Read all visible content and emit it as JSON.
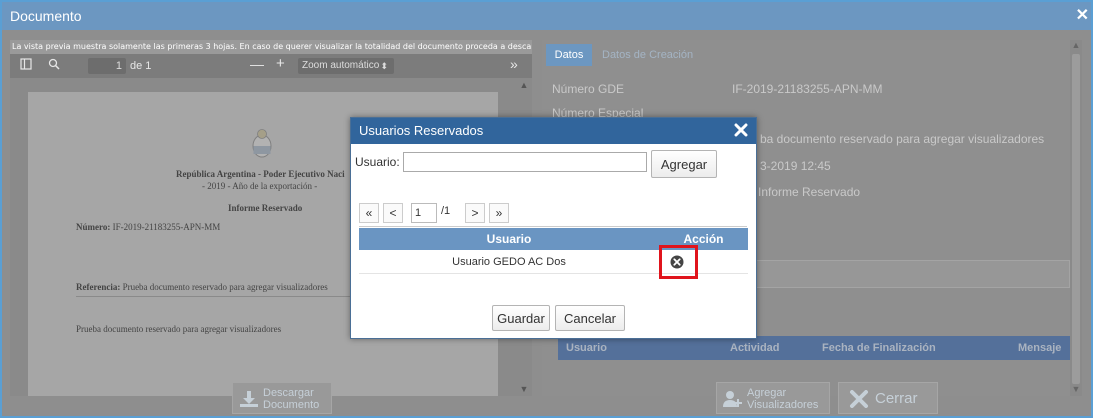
{
  "window": {
    "title": "Documento"
  },
  "viewer": {
    "notice": "La vista previa muestra solamente las primeras 3 hojas. En caso de querer visualizar la totalidad del documento proceda a descargarlo.",
    "page_current": "1",
    "page_total": "de 1",
    "zoom_minus": "—",
    "zoom_plus": "+",
    "zoom_value": "Zoom automático",
    "more": "»",
    "document": {
      "header_line": "República Argentina - Poder Ejecutivo Naci",
      "subheader": "- 2019 - Año de la exportación -",
      "doc_title": "Informe Reservado",
      "numero_label": "Número:",
      "numero_value": "IF-2019-21183255-APN-MM",
      "referencia_label": "Referencia:",
      "referencia_value": "Prueba documento reservado para agregar visualizadores",
      "body": "Prueba documento reservado para agregar visualizadores"
    }
  },
  "details": {
    "tabs": [
      {
        "label": "Datos"
      },
      {
        "label": "Datos de Creación"
      }
    ],
    "numero_gde_label": "Número GDE",
    "numero_gde_value": "IF-2019-21183255-APN-MM",
    "numero_especial_label": "Número Especial",
    "referencia_value": "ba documento reservado para agregar visualizadores",
    "fecha_value": "3-2019 12:45",
    "tipo_value": "Informe Reservado",
    "table_headers": [
      "Usuario",
      "Actividad",
      "Fecha de Finalización",
      "Mensaje"
    ]
  },
  "footer": {
    "descargar": {
      "line1": "Descargar",
      "line2": "Documento"
    },
    "agregar": {
      "line1": "Agregar",
      "line2": "Visualizadores"
    },
    "cerrar": "Cerrar"
  },
  "modal": {
    "title": "Usuarios Reservados",
    "usuario_label": "Usuario:",
    "usuario_value": "",
    "agregar_label": "Agregar",
    "pager": {
      "first": "«",
      "prev": "<",
      "page": "1",
      "of": "/1",
      "next": ">",
      "last": "»"
    },
    "table": {
      "headers": {
        "usuario": "Usuario",
        "accion": "Acción"
      },
      "rows": [
        {
          "usuario": "Usuario GEDO AC Dos"
        }
      ]
    },
    "guardar_label": "Guardar",
    "cancelar_label": "Cancelar"
  },
  "colors": {
    "titlebar": "#6c97c1",
    "modal_title": "#31659c",
    "table_header": "#6a95c2",
    "highlight": "#e0141c"
  }
}
